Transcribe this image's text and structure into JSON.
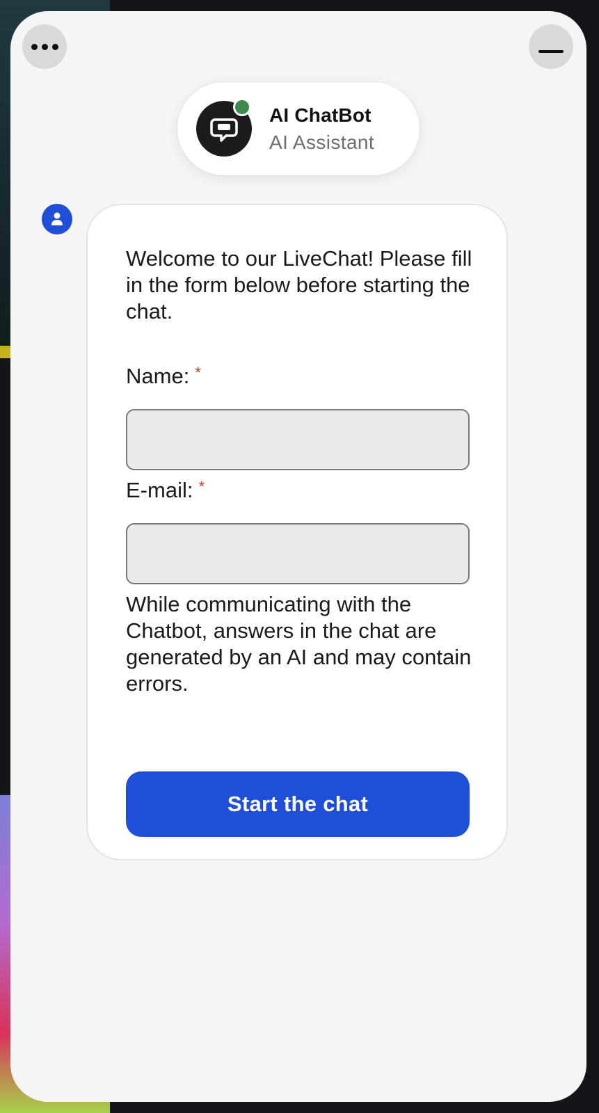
{
  "colors": {
    "accent": "#1f4fd9",
    "online": "#3e8a4c",
    "required": "#c0392b",
    "widget_bg": "#f5f5f5"
  },
  "header": {
    "menu_icon": "more-horizontal-icon",
    "minimize_icon": "minimize-icon",
    "bot_name": "AI ChatBot",
    "bot_role": "AI Assistant",
    "avatar_icon": "chat-bubble-icon",
    "status": "online"
  },
  "message": {
    "sender_icon": "user-icon",
    "welcome": "Welcome to our LiveChat! Please fill in the form below before starting the chat."
  },
  "form": {
    "fields": [
      {
        "label": "Name:",
        "required_mark": "*",
        "value": ""
      },
      {
        "label": "E-mail:",
        "required_mark": "*",
        "value": ""
      }
    ],
    "disclaimer": "While communicating with the Chatbot, answers in the chat are generated by an AI and may contain errors.",
    "submit_label": "Start the chat"
  }
}
